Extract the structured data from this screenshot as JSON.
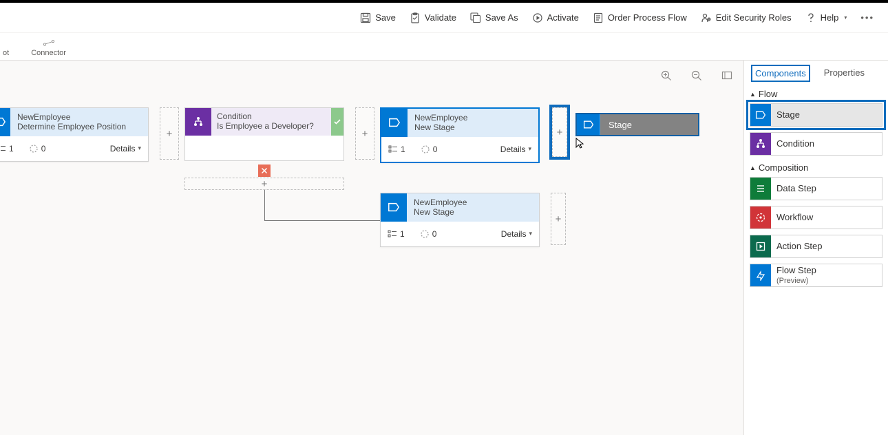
{
  "toolbar": {
    "save": "Save",
    "validate": "Validate",
    "save_as": "Save As",
    "activate": "Activate",
    "order": "Order Process Flow",
    "security": "Edit Security Roles",
    "help": "Help"
  },
  "sub_toolbar": {
    "snapshot_cut": "ot",
    "connector": "Connector"
  },
  "canvas": {
    "stage1": {
      "title": "NewEmployee",
      "sub": "Determine Employee Position",
      "steps": "1",
      "progress": "0",
      "details": "Details"
    },
    "condition": {
      "title": "Condition",
      "sub": "Is Employee a Developer?"
    },
    "stage2": {
      "title": "NewEmployee",
      "sub": "New Stage",
      "steps": "1",
      "progress": "0",
      "details": "Details"
    },
    "stage3": {
      "title": "NewEmployee",
      "sub": "New Stage",
      "steps": "1",
      "progress": "0",
      "details": "Details"
    },
    "ghost": {
      "label": "Stage"
    }
  },
  "side_panel": {
    "tabs": {
      "components": "Components",
      "properties": "Properties"
    },
    "section_flow": "Flow",
    "section_comp": "Composition",
    "items": {
      "stage": "Stage",
      "condition": "Condition",
      "data_step": "Data Step",
      "workflow": "Workflow",
      "action_step": "Action Step",
      "flow_step": "Flow Step",
      "flow_step_sub": "(Preview)"
    }
  }
}
